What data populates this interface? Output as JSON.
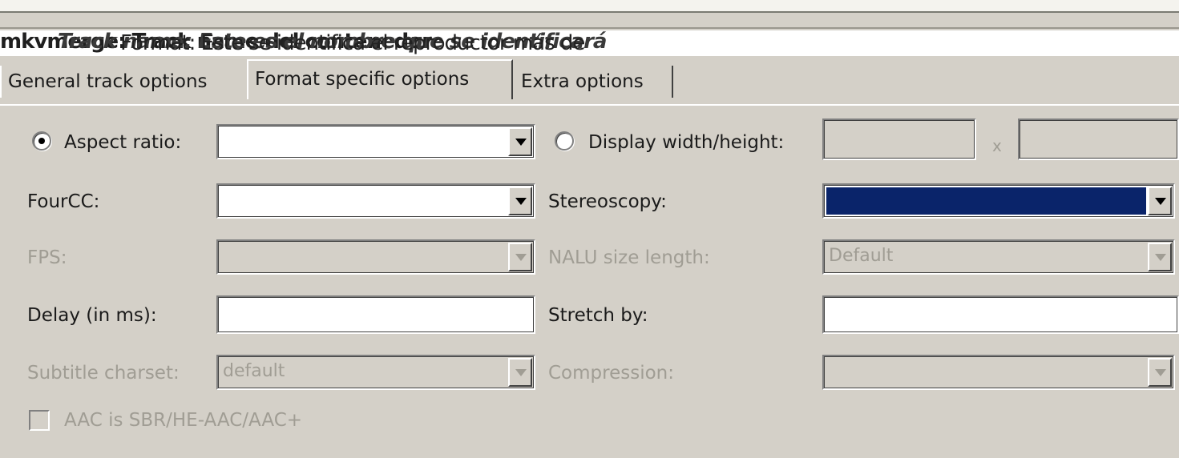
{
  "overlay_text": {
    "line1": "mkvmerge: Track name del contenedor",
    "line2": "Track name: Este es el nombre que se identificará",
    "line3": "Format: Este se identifica el reproductor más de"
  },
  "tabs": [
    {
      "label": "General track options",
      "selected": false
    },
    {
      "label": "Format specific options",
      "selected": true
    },
    {
      "label": "Extra options",
      "selected": false
    }
  ],
  "form": {
    "aspect_ratio": {
      "label": "Aspect ratio:",
      "value": ""
    },
    "display_wh": {
      "label": "Display width/height:",
      "width": "",
      "height": "",
      "separator": "x"
    },
    "fourcc": {
      "label": "FourCC:",
      "value": ""
    },
    "stereoscopy": {
      "label": "Stereoscopy:",
      "value": ""
    },
    "fps": {
      "label": "FPS:",
      "value": ""
    },
    "nalu": {
      "label": "NALU size length:",
      "value": "Default"
    },
    "delay": {
      "label": "Delay (in ms):",
      "value": ""
    },
    "stretch": {
      "label": "Stretch by:",
      "value": ""
    },
    "subtitle_charset": {
      "label": "Subtitle charset:",
      "value": "default"
    },
    "compression": {
      "label": "Compression:",
      "value": ""
    },
    "aac_sbr": {
      "label": "AAC is SBR/HE-AAC/AAC+",
      "checked": false
    }
  },
  "colors": {
    "face": "#d4d0c8",
    "selection": "#0a246a",
    "disabled_text": "#a09d94"
  }
}
